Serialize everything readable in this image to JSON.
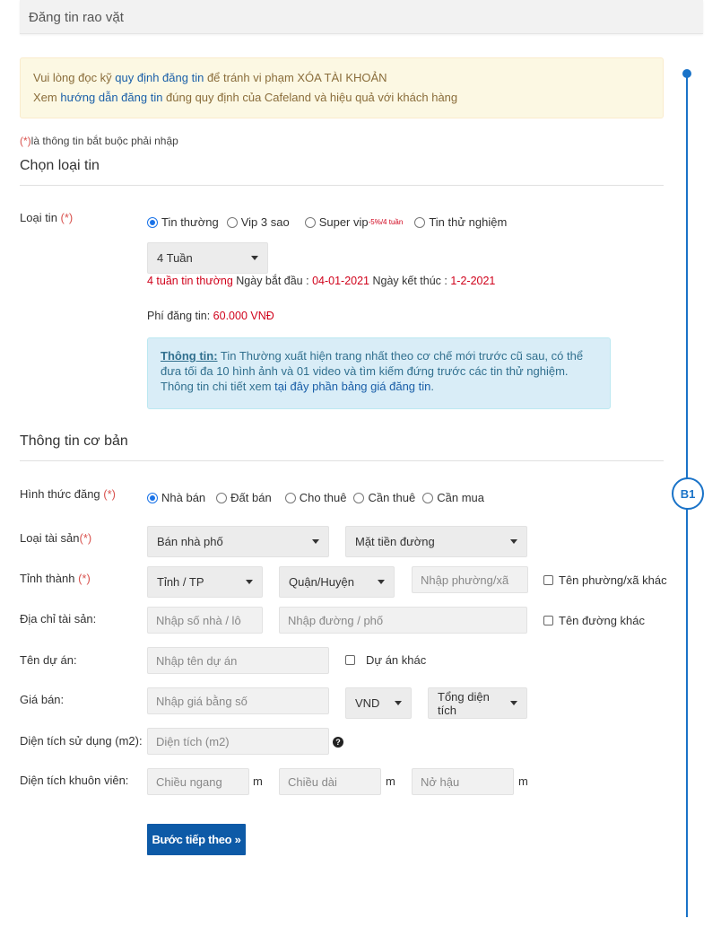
{
  "header": {
    "title": "Đăng tin rao vặt"
  },
  "notice": {
    "line1_prefix": "Vui lòng đọc kỹ ",
    "line1_link": "quy định đăng tin",
    "line1_suffix": " để tránh vi phạm XÓA TÀI KHOẢN",
    "line2_prefix": "Xem ",
    "line2_link": "hướng dẫn đăng tin",
    "line2_suffix": " đúng quy định của Cafeland và hiệu quả với khách hàng"
  },
  "required_note": {
    "mark": "(*)",
    "text": "là thông tin bắt buộc phải nhập"
  },
  "section1": {
    "title": "Chọn loại tin"
  },
  "loai_tin": {
    "label": "Loại tin",
    "req": "(*)",
    "options": [
      {
        "label": "Tin thường",
        "checked": true
      },
      {
        "label": "Vip 3 sao",
        "checked": false
      },
      {
        "label": "Super vip",
        "checked": false,
        "sup": "-5%/4 tuần"
      },
      {
        "label": "Tin thử nghiệm",
        "checked": false
      }
    ],
    "duration_select": "4 Tuần",
    "duration_text_red": "4 tuần tin thường",
    "start_label": " Ngày bắt đầu : ",
    "start_value": "04-01-2021",
    "end_label": " Ngày kết thúc : ",
    "end_value": "1-2-2021",
    "fee_label": "Phí đăng tin: ",
    "fee_value": "60.000 VNĐ"
  },
  "info_box": {
    "title": "Thông tin:",
    "text": " Tin Thường xuất hiện trang nhất theo cơ chế mới trước cũ sau, có thể đưa tối đa 10 hình ảnh và 01 video và tìm kiếm đứng trước các tin thử nghiệm. Thông tin chi tiết xem ",
    "link": "tại đây phần bảng giá đăng tin",
    "end": "."
  },
  "section2": {
    "title": "Thông tin cơ bản"
  },
  "hinh_thuc": {
    "label": "Hình thức đăng",
    "req": "(*)",
    "options": [
      {
        "label": "Nhà bán",
        "checked": true
      },
      {
        "label": "Đất bán",
        "checked": false
      },
      {
        "label": "Cho thuê",
        "checked": false
      },
      {
        "label": "Cần thuê",
        "checked": false
      },
      {
        "label": "Cần mua",
        "checked": false
      }
    ]
  },
  "loai_tai_san": {
    "label": "Loại tài sản",
    "req": "(*)",
    "select1": "Bán nhà phố",
    "select2": "Mặt tiền đường"
  },
  "tinh_thanh": {
    "label": "Tỉnh thành",
    "req": "(*)",
    "select1": "Tỉnh / TP",
    "select2": "Quận/Huyện",
    "ward_placeholder": "Nhập phường/xã",
    "other_ward": "Tên phường/xã khác"
  },
  "dia_chi": {
    "label": "Địa chỉ tài sản:",
    "house_placeholder": "Nhập số nhà / lô",
    "street_placeholder": "Nhập đường / phố",
    "other_street": "Tên đường khác"
  },
  "du_an": {
    "label": "Tên dự án:",
    "placeholder": "Nhập tên dự án",
    "other": "Dự án khác"
  },
  "gia_ban": {
    "label": "Giá bán:",
    "placeholder": "Nhập giá bằng số",
    "currency": "VND",
    "unit": "Tổng diện tích"
  },
  "dien_tich": {
    "label": "Diện tích sử dụng (m2):",
    "placeholder": "Diện tích (m2)",
    "help": "?"
  },
  "khuon_vien": {
    "label": "Diện tích khuôn viên:",
    "width_placeholder": "Chiều ngang",
    "length_placeholder": "Chiều dài",
    "back_placeholder": "Nở hậu",
    "unit": "m"
  },
  "next_button": {
    "label": "Bước tiếp theo »"
  },
  "timeline": {
    "badge": "B1",
    "accent": "#1a73c8"
  }
}
